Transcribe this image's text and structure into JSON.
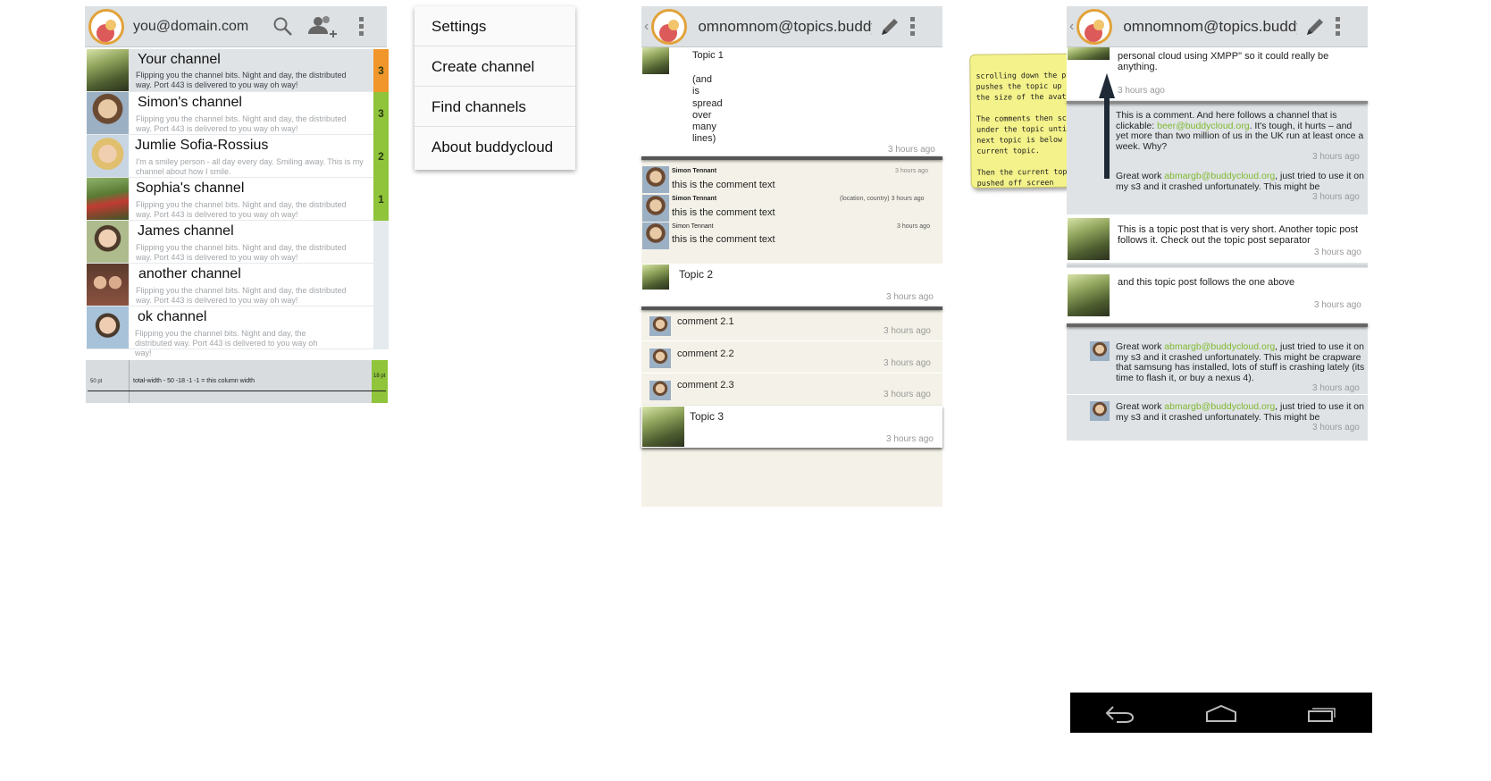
{
  "panel1": {
    "account": "you@domain.com",
    "channels": [
      {
        "name": "Your channel",
        "desc": "Flipping you the channel bits. Night and day, the distributed way. Port 443 is delivered to you way oh way!",
        "badge": "3",
        "badge_color": "#f0962b"
      },
      {
        "name": "Simon's channel",
        "desc": "Flipping you the channel bits. Night and day, the distributed way. Port 443 is delivered to you way oh way!",
        "badge": "3",
        "badge_color": "#8fc43b"
      },
      {
        "name": "Jumlie Sofia-Rossius",
        "desc": "I'm a smiley person - all day every day. Smiling away. This is my channel about how I smile.",
        "badge": "2",
        "badge_color": "#8fc43b"
      },
      {
        "name": "Sophia's channel",
        "desc": "Flipping you the channel bits. Night and day, the distributed way. Port 443 is delivered to you way oh way!",
        "badge": "1",
        "badge_color": "#8fc43b"
      },
      {
        "name": "James channel",
        "desc": "Flipping you the channel bits. Night and day, the distributed way. Port 443 is delivered to you way oh way!",
        "badge": "",
        "badge_color": "#e4eaee"
      },
      {
        "name": "another channel",
        "desc": "Flipping you the channel bits. Night and day, the distributed way. Port 443 is delivered to you way oh way!",
        "badge": "",
        "badge_color": "#e4eaee"
      },
      {
        "name": "ok channel",
        "desc": "Flipping you the channel bits. Night and day, the distributed way. Port 443 is delivered to you way oh way!",
        "badge": "",
        "badge_color": "#e4eaee"
      }
    ],
    "spec": {
      "left": "50 pt",
      "middle": "total-width - 50 -18 -1 -1 = this column width",
      "right": "18 pt"
    }
  },
  "menu": [
    "Settings",
    "Create channel",
    "Find channels",
    "About buddycloud"
  ],
  "panel3": {
    "title": "omnomnom@topics.buddy...",
    "topic1": {
      "title": "Topic 1",
      "lines": [
        "(and",
        "is",
        "spread",
        "over",
        "many",
        "lines)"
      ],
      "time": "3 hours ago"
    },
    "comments1": [
      {
        "author": "Simon Tennant",
        "info": "3 hours ago",
        "text": "this is the comment text"
      },
      {
        "author": "Simon Tennant",
        "info": "(location, country) 3 hours ago",
        "text": "this is the comment text"
      },
      {
        "author": "Simon Tennant",
        "info": "3 hours ago",
        "text": "this is the comment text"
      }
    ],
    "topic2": {
      "title": "Topic 2",
      "time": "3 hours ago"
    },
    "comments2": [
      {
        "text": "comment 2.1",
        "time": "3 hours ago"
      },
      {
        "text": "comment 2.2",
        "time": "3 hours ago"
      },
      {
        "text": "comment 2.3",
        "time": "3 hours ago"
      }
    ],
    "topic3": {
      "title": "Topic 3",
      "time": "3 hours ago"
    }
  },
  "note": {
    "p1": "scrolling down the page pushes the topic up to just the size of the avatar.",
    "p2": "The comments then scroll under the topic until the next topic is below the current topic.",
    "p3": "Then the current topic is pushed off screen"
  },
  "panel4": {
    "title": "omnomnom@topics.buddy...",
    "top_text": "personal cloud using XMPP\" so it could really be anything.",
    "top_time": "3 hours ago",
    "c1_a": "This is a comment. And here follows a channel that is clickable: ",
    "c1_link": "beer@buddycloud.org",
    "c1_b": ". It's tough, it hurts – and yet more than two million of us in the UK run at least once a week. Why?",
    "c1_time": "3 hours ago",
    "c2_a": "Great work ",
    "c2_link": "abmargb@buddycloud.org",
    "c2_b": ", just tried to use it on my s3 and it crashed unfortunately. This might be",
    "c2_time": "3 hours ago",
    "post1": "This is a topic post that is very short. Another topic post follows it. Check out the topic post separator",
    "post1_time": "3 hours ago",
    "post2": "and this topic post follows the one above",
    "post2_time": "3 hours ago",
    "c3_a": "Great work ",
    "c3_link": "abmargb@buddycloud.org",
    "c3_b": ", just tried to use it on my s3 and it crashed unfortunately. This might be crapware that samsung has installed, lots of stuff is crashing lately (its time to flash it, or buy a nexus 4).",
    "c3_time": "3 hours ago",
    "c4_a": "Great work ",
    "c4_link": "abmargb@buddycloud.org",
    "c4_b": ", just tried to use it on my s3 and it crashed unfortunately. This might be",
    "c4_time": "3 hours ago"
  },
  "icons": {
    "search": "search-icon",
    "add_user": "add-user-icon",
    "overflow": "overflow-menu-icon",
    "edit": "pencil-icon",
    "back": "back-icon",
    "home": "home-icon",
    "recents": "recent-apps-icon"
  }
}
